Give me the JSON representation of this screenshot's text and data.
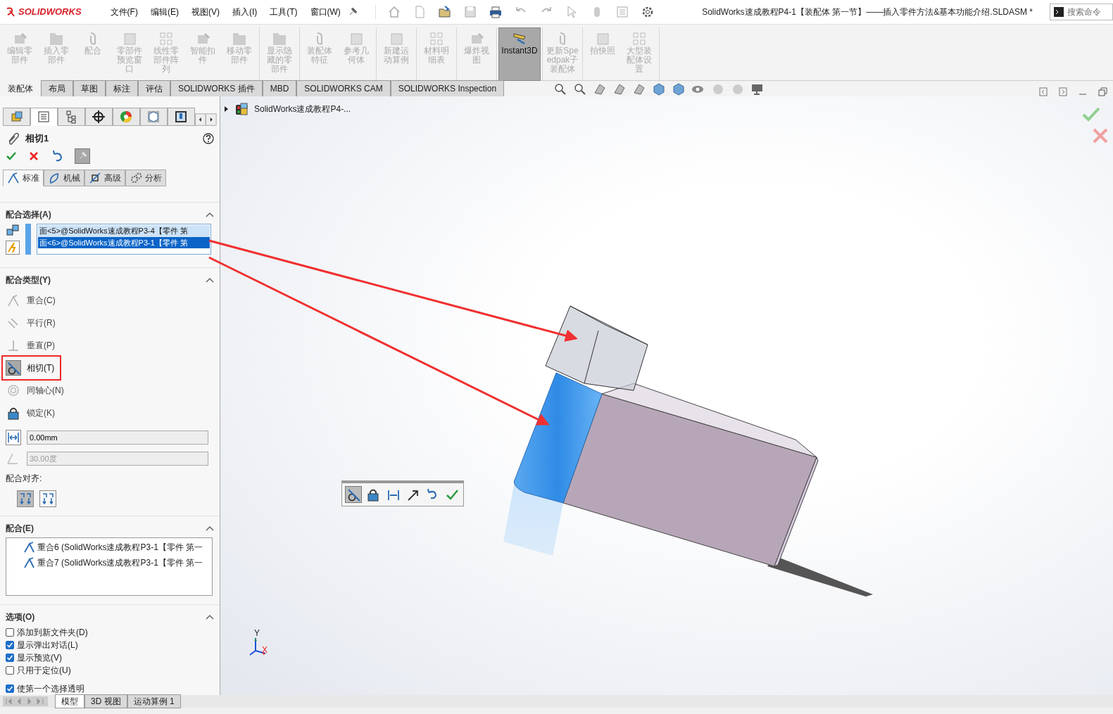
{
  "app": {
    "logo": "SOLIDWORKS",
    "title": "SolidWorks速成教程P4-1【装配体  第一节】——插入零件方法&基本功能介绍.SLDASM *",
    "search": {
      "placeholder": "搜索命令"
    }
  },
  "menu": [
    "文件(F)",
    "编辑(E)",
    "视图(V)",
    "插入(I)",
    "工具(T)",
    "窗口(W)"
  ],
  "ribbon": [
    [
      {
        "label": "编辑零部件",
        "disabled": true,
        "selected": false
      },
      {
        "label": "插入零部件",
        "disabled": true,
        "selected": false
      },
      {
        "label": "配合",
        "disabled": true,
        "selected": false
      },
      {
        "label": "零部件预览窗口",
        "disabled": true,
        "selected": false
      },
      {
        "label": "线性零部件阵列",
        "disabled": true,
        "selected": false
      },
      {
        "label": "智能扣件",
        "disabled": true,
        "selected": false
      },
      {
        "label": "移动零部件",
        "disabled": true,
        "selected": false
      }
    ],
    [
      {
        "label": "显示隐藏的零部件",
        "disabled": true,
        "selected": false
      }
    ],
    [
      {
        "label": "装配体特征",
        "disabled": true,
        "selected": false
      },
      {
        "label": "参考几何体",
        "disabled": true,
        "selected": false
      }
    ],
    [
      {
        "label": "新建运动算例",
        "disabled": true,
        "selected": false
      }
    ],
    [
      {
        "label": "材料明细表",
        "disabled": true,
        "selected": false
      }
    ],
    [
      {
        "label": "爆炸视图",
        "disabled": true,
        "selected": false
      }
    ],
    [
      {
        "label": "Instant3D",
        "disabled": false,
        "selected": true
      }
    ],
    [
      {
        "label": "更新Speedpak子装配体",
        "disabled": true,
        "selected": false
      }
    ],
    [
      {
        "label": "拍快照",
        "disabled": true,
        "selected": false
      },
      {
        "label": "大型装配体设置",
        "disabled": true,
        "selected": false
      }
    ]
  ],
  "command_tabs": [
    {
      "label": "装配体",
      "selected": true
    },
    {
      "label": "布局",
      "selected": false
    },
    {
      "label": "草图",
      "selected": false
    },
    {
      "label": "标注",
      "selected": false
    },
    {
      "label": "评估",
      "selected": false
    },
    {
      "label": "SOLIDWORKS 插件",
      "selected": false
    },
    {
      "label": "MBD",
      "selected": false
    },
    {
      "label": "SOLIDWORKS CAM",
      "selected": false
    },
    {
      "label": "SOLIDWORKS Inspection",
      "selected": false
    }
  ],
  "panel_tabs": [
    {
      "selected": false
    },
    {
      "selected": true
    },
    {
      "selected": false
    },
    {
      "selected": false
    },
    {
      "selected": false
    },
    {
      "selected": false
    },
    {
      "selected": false
    }
  ],
  "property_manager": {
    "title": "相切1",
    "mate_tabs": [
      {
        "label": "标准",
        "selected": true
      },
      {
        "label": "机械",
        "selected": false
      },
      {
        "label": "高级",
        "selected": false
      },
      {
        "label": "分析",
        "selected": false
      }
    ],
    "mate_selections": {
      "title": "配合选择(A)",
      "items": [
        {
          "text": "面<5>@SolidWorks速成教程P3-4【零件  第",
          "selected": false
        },
        {
          "text": "面<6>@SolidWorks速成教程P3-1【零件  第",
          "selected": true
        }
      ]
    },
    "mate_types": {
      "title": "配合类型(Y)",
      "items": [
        {
          "label": "重合(C)",
          "selected": false,
          "annotated": false
        },
        {
          "label": "平行(R)",
          "selected": false,
          "annotated": false
        },
        {
          "label": "垂直(P)",
          "selected": false,
          "annotated": false
        },
        {
          "label": "相切(T)",
          "selected": true,
          "annotated": true
        },
        {
          "label": "同轴心(N)",
          "selected": false,
          "annotated": false
        },
        {
          "label": "锁定(K)",
          "selected": false,
          "annotated": false
        }
      ]
    },
    "distance": {
      "value": "0.00mm"
    },
    "angle": {
      "value": "30.00度",
      "disabled": true
    },
    "alignment": {
      "label": "配合对齐:",
      "options": [
        {
          "selected": true
        },
        {
          "selected": false
        }
      ]
    },
    "mates": {
      "title": "配合(E)",
      "items": [
        "重合6 (SolidWorks速成教程P3-1【零件  第一",
        "重合7 (SolidWorks速成教程P3-1【零件  第一"
      ]
    },
    "options": {
      "title": "选项(O)",
      "items": [
        {
          "label": "添加到新文件夹(D)",
          "checked": false
        },
        {
          "label": "显示弹出对话(L)",
          "checked": true
        },
        {
          "label": "显示预览(V)",
          "checked": true
        },
        {
          "label": "只用于定位(U)",
          "checked": false
        },
        {
          "label": "使第一个选择透明",
          "checked": true
        }
      ]
    }
  },
  "bottom_tabs": [
    {
      "label": "模型",
      "selected": true
    },
    {
      "label": "3D 视图",
      "selected": false
    },
    {
      "label": "运动算例 1",
      "selected": false
    }
  ],
  "viewport": {
    "tree_item": "SolidWorks速成教程P4-...",
    "axis_labels": [
      "Y",
      "X"
    ],
    "context_toolbar": [
      {
        "selected": true
      },
      {
        "selected": false
      },
      {
        "selected": false
      },
      {
        "selected": false
      },
      {
        "selected": false
      },
      {
        "selected": false
      }
    ]
  }
}
